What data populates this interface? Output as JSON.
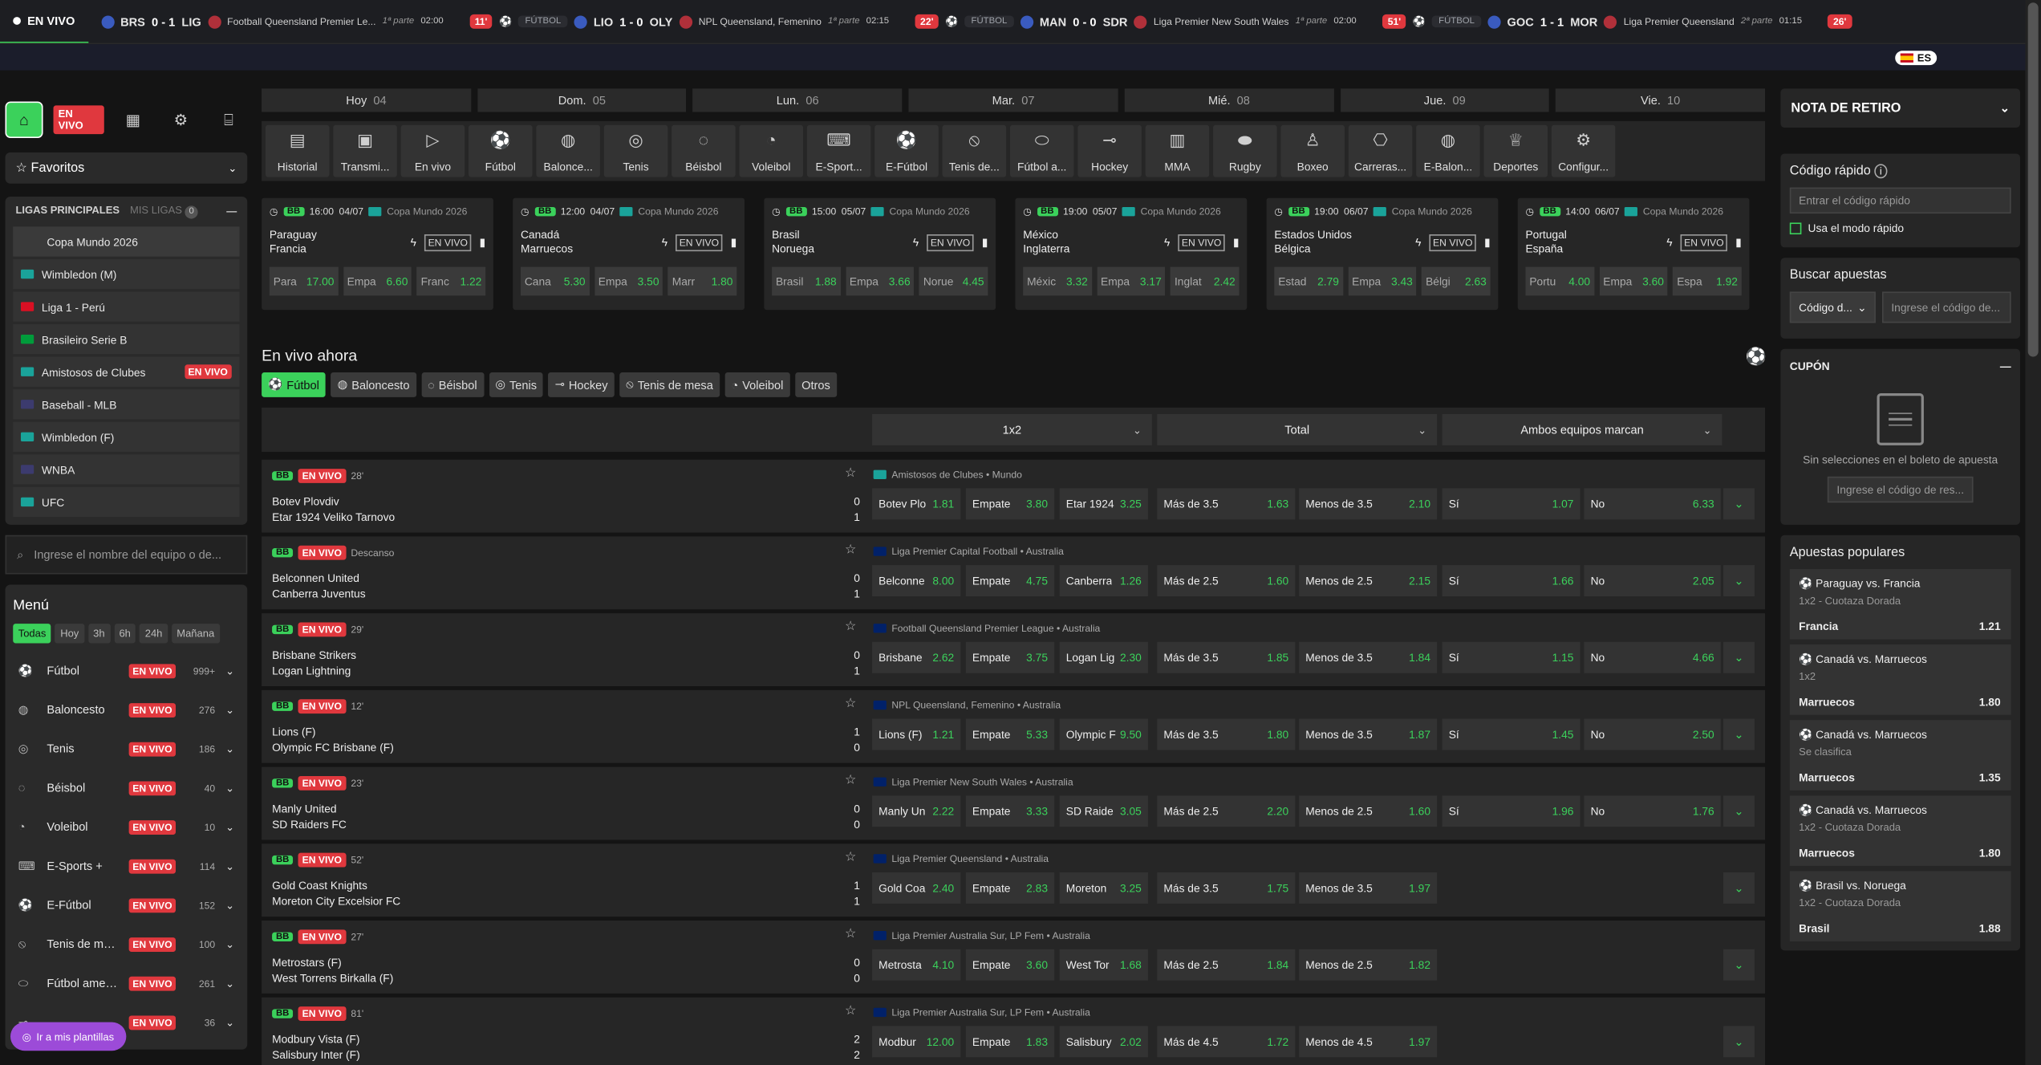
{
  "ticker": {
    "live_label": "EN VIVO",
    "items": [
      {
        "home": "BRS",
        "score": "0 - 1",
        "away": "LIG",
        "league": "Football Queensland Premier Le...",
        "phase": "1ª parte",
        "clock": "02:00",
        "minute": "",
        "sport": ""
      },
      {
        "home": "LIO",
        "score": "1 - 0",
        "away": "OLY",
        "league": "NPL Queensland, Femenino",
        "phase": "1ª parte",
        "clock": "02:15",
        "minute": "11'",
        "sport": "FÚTBOL"
      },
      {
        "home": "MAN",
        "score": "0 - 0",
        "away": "SDR",
        "league": "Liga Premier New South Wales",
        "phase": "1ª parte",
        "clock": "02:00",
        "minute": "22'",
        "sport": "FÚTBOL"
      },
      {
        "home": "GOC",
        "score": "1 - 1",
        "away": "MOR",
        "league": "Liga Premier Queensland",
        "phase": "2ª parte",
        "clock": "01:15",
        "minute": "51'",
        "sport": "FÚTBOL"
      },
      {
        "home": "",
        "score": "",
        "away": "",
        "league": "",
        "phase": "",
        "clock": "",
        "minute": "26'",
        "sport": ""
      }
    ]
  },
  "lang": "ES",
  "sidebar": {
    "live_badge": "EN VIVO",
    "favorites": "Favoritos",
    "leagues_title": "LIGAS PRINCIPALES",
    "my_leagues": "MIS LIGAS",
    "my_leagues_count": "0",
    "leagues": [
      {
        "name": "Copa Mundo 2026",
        "flag": "none",
        "live": ""
      },
      {
        "name": "Wimbledon (M)",
        "flag": "#1aa39a",
        "live": ""
      },
      {
        "name": "Liga 1 - Perú",
        "flag": "#d91023",
        "live": ""
      },
      {
        "name": "Brasileiro Serie B",
        "flag": "#009c3b",
        "live": ""
      },
      {
        "name": "Amistosos de Clubes",
        "flag": "#1aa39a",
        "live": "EN VIVO"
      },
      {
        "name": "Baseball - MLB",
        "flag": "#3c3b6e",
        "live": ""
      },
      {
        "name": "Wimbledon (F)",
        "flag": "#1aa39a",
        "live": ""
      },
      {
        "name": "WNBA",
        "flag": "#3c3b6e",
        "live": ""
      },
      {
        "name": "UFC",
        "flag": "#1aa39a",
        "live": ""
      }
    ],
    "search_placeholder": "Ingrese el nombre del equipo o de...",
    "menu_title": "Menú",
    "filters": [
      "Todas",
      "Hoy",
      "3h",
      "6h",
      "24h",
      "Mañana"
    ],
    "sports": [
      {
        "name": "Fútbol",
        "count": "999+",
        "icon": "soccer-icon"
      },
      {
        "name": "Baloncesto",
        "count": "276",
        "icon": "basketball-icon"
      },
      {
        "name": "Tenis",
        "count": "186",
        "icon": "tennis-icon"
      },
      {
        "name": "Béisbol",
        "count": "40",
        "icon": "baseball-icon"
      },
      {
        "name": "Voleibol",
        "count": "10",
        "icon": "volleyball-icon"
      },
      {
        "name": "E-Sports +",
        "count": "114",
        "icon": "gamepad-icon"
      },
      {
        "name": "E-Fútbol",
        "count": "152",
        "icon": "esoccer-icon"
      },
      {
        "name": "Tenis de me...",
        "count": "100",
        "icon": "table-tennis-icon"
      },
      {
        "name": "Fútbol americano",
        "count": "261",
        "icon": "football-icon"
      },
      {
        "name": "",
        "count": "36",
        "icon": "hockey-icon"
      }
    ],
    "plantillas": "Ir a mis plantillas"
  },
  "days": [
    [
      "Hoy",
      "04"
    ],
    [
      "Dom.",
      "05"
    ],
    [
      "Lun.",
      "06"
    ],
    [
      "Mar.",
      "07"
    ],
    [
      "Mié.",
      "08"
    ],
    [
      "Jue.",
      "09"
    ],
    [
      "Vie.",
      "10"
    ]
  ],
  "sport_tabs": [
    "Historial",
    "Transmi...",
    "En vivo",
    "Fútbol",
    "Balonce...",
    "Tenis",
    "Béisbol",
    "Voleibol",
    "E-Sport...",
    "E-Fútbol",
    "Tenis de...",
    "Fútbol a...",
    "Hockey",
    "MMA",
    "Rugby",
    "Boxeo",
    "Carreras...",
    "E-Balon...",
    "Deportes",
    "Configur..."
  ],
  "featured": [
    {
      "time": "16:00",
      "date": "04/07",
      "comp": "Copa Mundo 2026",
      "t1": "Paraguay",
      "t2": "Francia",
      "o": [
        [
          "Para",
          "17.00"
        ],
        [
          "Empa",
          "6.60"
        ],
        [
          "Franc",
          "1.22"
        ]
      ]
    },
    {
      "time": "12:00",
      "date": "04/07",
      "comp": "Copa Mundo 2026",
      "t1": "Canadá",
      "t2": "Marruecos",
      "o": [
        [
          "Cana",
          "5.30"
        ],
        [
          "Empa",
          "3.50"
        ],
        [
          "Marr",
          "1.80"
        ]
      ]
    },
    {
      "time": "15:00",
      "date": "05/07",
      "comp": "Copa Mundo 2026",
      "t1": "Brasil",
      "t2": "Noruega",
      "o": [
        [
          "Brasil",
          "1.88"
        ],
        [
          "Empa",
          "3.66"
        ],
        [
          "Norue",
          "4.45"
        ]
      ]
    },
    {
      "time": "19:00",
      "date": "05/07",
      "comp": "Copa Mundo 2026",
      "t1": "México",
      "t2": "Inglaterra",
      "o": [
        [
          "Méxic",
          "3.32"
        ],
        [
          "Empa",
          "3.17"
        ],
        [
          "Inglat",
          "2.42"
        ]
      ]
    },
    {
      "time": "19:00",
      "date": "06/07",
      "comp": "Copa Mundo 2026",
      "t1": "Estados Unidos",
      "t2": "Bélgica",
      "o": [
        [
          "Estad",
          "2.79"
        ],
        [
          "Empa",
          "3.43"
        ],
        [
          "Bélgi",
          "2.63"
        ]
      ]
    },
    {
      "time": "14:00",
      "date": "06/07",
      "comp": "Copa Mundo 2026",
      "t1": "Portugal",
      "t2": "España",
      "o": [
        [
          "Portu",
          "4.00"
        ],
        [
          "Empa",
          "3.60"
        ],
        [
          "Espa",
          "1.92"
        ]
      ]
    }
  ],
  "featured_badge": "BB",
  "featured_live": "EN VIVO",
  "live_now": {
    "title": "En vivo ahora",
    "tabs": [
      "Fútbol",
      "Baloncesto",
      "Béisbol",
      "Tenis",
      "Hockey",
      "Tenis de mesa",
      "Voleibol",
      "Otros"
    ],
    "markets": [
      "1x2",
      "Total",
      "Ambos equipos marcan"
    ]
  },
  "events": [
    {
      "min": "28'",
      "t1": "Botev Plovdiv",
      "t2": "Etar 1924 Veliko Tarnovo",
      "s1": "0",
      "s2": "1",
      "league": "Amistosos de Clubes • Mundo",
      "flag": "#1aa39a",
      "o": [
        [
          "Botev Plo",
          "1.81"
        ],
        [
          "Empate",
          "3.80"
        ],
        [
          "Etar 1924",
          "3.25"
        ],
        [
          "Más de 3.5",
          "1.63"
        ],
        [
          "Menos de 3.5",
          "2.10"
        ],
        [
          "Sí",
          "1.07"
        ],
        [
          "No",
          "6.33"
        ]
      ]
    },
    {
      "min": "Descanso",
      "t1": "Belconnen United",
      "t2": "Canberra Juventus",
      "s1": "0",
      "s2": "1",
      "league": "Liga Premier Capital Football • Australia",
      "flag": "#012169",
      "o": [
        [
          "Belconne",
          "8.00"
        ],
        [
          "Empate",
          "4.75"
        ],
        [
          "Canberra",
          "1.26"
        ],
        [
          "Más de 2.5",
          "1.60"
        ],
        [
          "Menos de 2.5",
          "2.15"
        ],
        [
          "Sí",
          "1.66"
        ],
        [
          "No",
          "2.05"
        ]
      ]
    },
    {
      "min": "29'",
      "t1": "Brisbane Strikers",
      "t2": "Logan Lightning",
      "s1": "0",
      "s2": "1",
      "league": "Football Queensland Premier League • Australia",
      "flag": "#012169",
      "o": [
        [
          "Brisbane",
          "2.62"
        ],
        [
          "Empate",
          "3.75"
        ],
        [
          "Logan Lig",
          "2.30"
        ],
        [
          "Más de 3.5",
          "1.85"
        ],
        [
          "Menos de 3.5",
          "1.84"
        ],
        [
          "Sí",
          "1.15"
        ],
        [
          "No",
          "4.66"
        ]
      ]
    },
    {
      "min": "12'",
      "t1": "Lions (F)",
      "t2": "Olympic FC Brisbane (F)",
      "s1": "1",
      "s2": "0",
      "league": "NPL Queensland, Femenino • Australia",
      "flag": "#012169",
      "o": [
        [
          "Lions (F)",
          "1.21"
        ],
        [
          "Empate",
          "5.33"
        ],
        [
          "Olympic F",
          "9.50"
        ],
        [
          "Más de 3.5",
          "1.80"
        ],
        [
          "Menos de 3.5",
          "1.87"
        ],
        [
          "Sí",
          "1.45"
        ],
        [
          "No",
          "2.50"
        ]
      ]
    },
    {
      "min": "23'",
      "t1": "Manly United",
      "t2": "SD Raiders FC",
      "s1": "0",
      "s2": "0",
      "league": "Liga Premier New South Wales • Australia",
      "flag": "#012169",
      "o": [
        [
          "Manly Un",
          "2.22"
        ],
        [
          "Empate",
          "3.33"
        ],
        [
          "SD Raide",
          "3.05"
        ],
        [
          "Más de 2.5",
          "2.20"
        ],
        [
          "Menos de 2.5",
          "1.60"
        ],
        [
          "Sí",
          "1.96"
        ],
        [
          "No",
          "1.76"
        ]
      ]
    },
    {
      "min": "52'",
      "t1": "Gold Coast Knights",
      "t2": "Moreton City Excelsior FC",
      "s1": "1",
      "s2": "1",
      "league": "Liga Premier Queensland • Australia",
      "flag": "#012169",
      "o": [
        [
          "Gold Coa",
          "2.40"
        ],
        [
          "Empate",
          "2.83"
        ],
        [
          "Moreton",
          "3.25"
        ],
        [
          "Más de 3.5",
          "1.75"
        ],
        [
          "Menos de 3.5",
          "1.97"
        ]
      ]
    },
    {
      "min": "27'",
      "t1": "Metrostars (F)",
      "t2": "West Torrens Birkalla (F)",
      "s1": "0",
      "s2": "0",
      "league": "Liga Premier Australia Sur, LP Fem • Australia",
      "flag": "#012169",
      "o": [
        [
          "Metrosta",
          "4.10"
        ],
        [
          "Empate",
          "3.60"
        ],
        [
          "West Tor",
          "1.68"
        ],
        [
          "Más de 2.5",
          "1.84"
        ],
        [
          "Menos de 2.5",
          "1.82"
        ]
      ]
    },
    {
      "min": "81'",
      "t1": "Modbury Vista (F)",
      "t2": "Salisbury Inter (F)",
      "s1": "2",
      "s2": "2",
      "league": "Liga Premier Australia Sur, LP Fem • Australia",
      "flag": "#012169",
      "o": [
        [
          "Modbur",
          "12.00"
        ],
        [
          "Empate",
          "1.83"
        ],
        [
          "Salisbury",
          "2.02"
        ],
        [
          "Más de 4.5",
          "1.72"
        ],
        [
          "Menos de 4.5",
          "1.97"
        ]
      ]
    }
  ],
  "right": {
    "nota": "NOTA DE RETIRO",
    "quick_code": "Código rápido",
    "quick_placeholder": "Entrar el código rápido",
    "quick_mode": "Usa el modo rápido",
    "search_bets": "Buscar apuestas",
    "code_select": "Código d...",
    "code_placeholder": "Ingrese el código de...",
    "cupon": "CUPÓN",
    "cupon_empty": "Sin selecciones en el boleto de apuesta",
    "cupon_placeholder": "Ingrese el código de res...",
    "popular_title": "Apuestas populares",
    "popular": [
      {
        "match": "Paraguay vs. Francia",
        "market": "1x2 - Cuotaza Dorada",
        "pick": "Francia",
        "odd": "1.21"
      },
      {
        "match": "Canadá vs. Marruecos",
        "market": "1x2",
        "pick": "Marruecos",
        "odd": "1.80"
      },
      {
        "match": "Canadá vs. Marruecos",
        "market": "Se clasifica",
        "pick": "Marruecos",
        "odd": "1.35"
      },
      {
        "match": "Canadá vs. Marruecos",
        "market": "1x2 - Cuotaza Dorada",
        "pick": "Marruecos",
        "odd": "1.80"
      },
      {
        "match": "Brasil vs. Noruega",
        "market": "1x2 - Cuotaza Dorada",
        "pick": "Brasil",
        "odd": "1.88"
      }
    ]
  },
  "colors": {
    "accent": "#3bd15b",
    "live": "#e0383e"
  }
}
